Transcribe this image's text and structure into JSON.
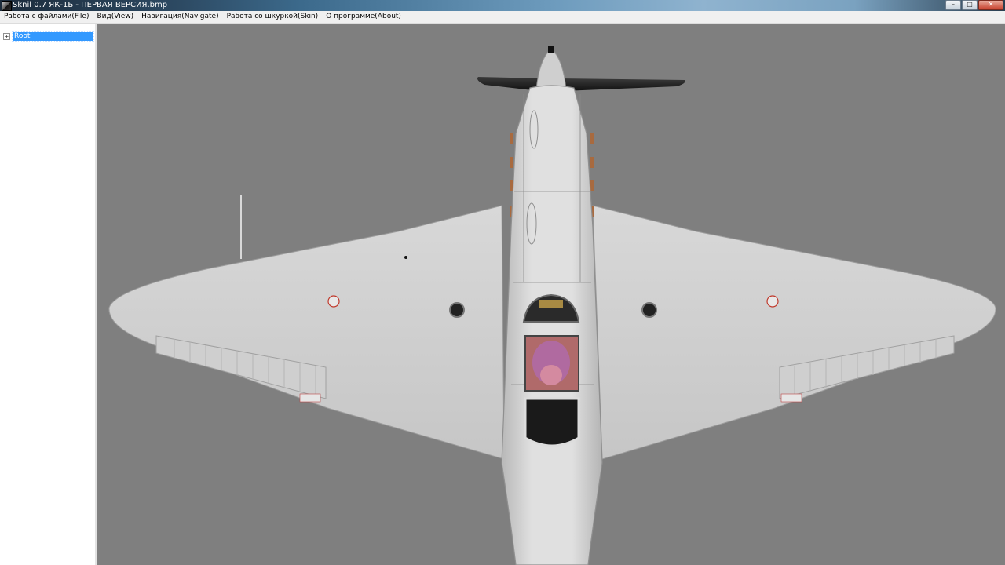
{
  "window": {
    "title": "Sknil 0.7   ЯК-1Б - ПЕРВАЯ ВЕРСИЯ.bmp",
    "minimize_glyph": "–",
    "maximize_glyph": "□",
    "close_glyph": "✕"
  },
  "menu": [
    {
      "label": "Работа с файлами(File)"
    },
    {
      "label": "Вид(View)"
    },
    {
      "label": "Навигация(Navigate)"
    },
    {
      "label": "Работа со шкуркой(Skin)"
    },
    {
      "label": "О программе(About)"
    }
  ],
  "tree": {
    "expander": "+",
    "root_label": "Root"
  },
  "viewport": {
    "subject": "yak-1b-aircraft-model",
    "colors": {
      "background": "#7f7f7f",
      "airframe": "#d4d4d4",
      "propeller": "#1e1e1e",
      "accent_red": "#c0392b",
      "canopy_pilot": "#b06aa0"
    }
  }
}
